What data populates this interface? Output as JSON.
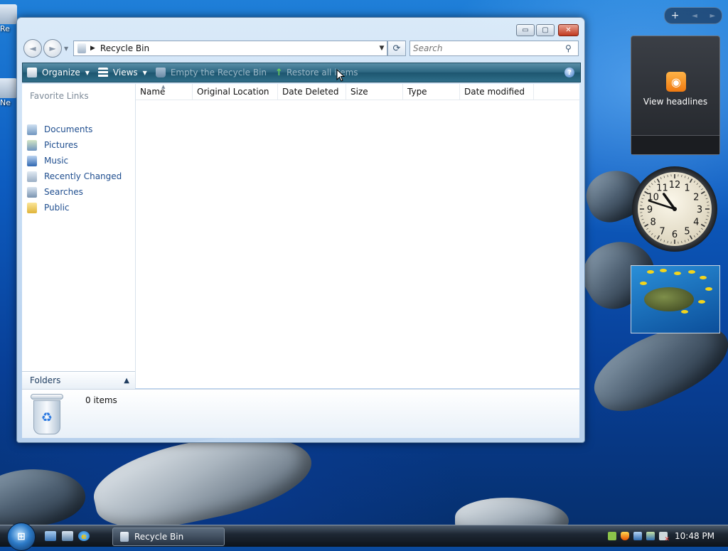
{
  "desktop": {
    "icons": [
      {
        "label": "Re"
      },
      {
        "label": "Ne"
      }
    ]
  },
  "sidebar": {
    "controls": {
      "add": "+",
      "prev": "◄",
      "next": "►"
    },
    "feed_gadget": {
      "text": "View headlines",
      "icon": "rss-icon"
    },
    "clock_gadget": {
      "numbers": [
        "12",
        "1",
        "2",
        "3",
        "4",
        "5",
        "6",
        "7",
        "8",
        "9",
        "10",
        "11"
      ],
      "hour": 10,
      "minute": 48
    },
    "slideshow_gadget": {
      "icon": "photo-turtle"
    }
  },
  "window": {
    "title": "Recycle Bin",
    "caption_buttons": {
      "minimize": "▭",
      "maximize": "▢",
      "close": "✕"
    },
    "address": {
      "path": "Recycle Bin"
    },
    "search": {
      "placeholder": "Search"
    },
    "toolbar": {
      "organize": "Organize",
      "views": "Views",
      "empty": "Empty the Recycle Bin",
      "restore": "Restore all items",
      "help": "?"
    },
    "nav_pane": {
      "title": "Favorite Links",
      "links": [
        {
          "label": "Documents",
          "icon": "documents-icon"
        },
        {
          "label": "Pictures",
          "icon": "pictures-icon"
        },
        {
          "label": "Music",
          "icon": "music-icon"
        },
        {
          "label": "Recently Changed",
          "icon": "recently-changed-icon"
        },
        {
          "label": "Searches",
          "icon": "searches-icon"
        },
        {
          "label": "Public",
          "icon": "public-folder-icon"
        }
      ],
      "folders_label": "Folders"
    },
    "columns": [
      "Name",
      "Original Location",
      "Date Deleted",
      "Size",
      "Type",
      "Date modified"
    ],
    "items": [],
    "details": {
      "count_text": "0 items"
    }
  },
  "taskbar": {
    "task_label": "Recycle Bin",
    "clock": "10:48 PM"
  },
  "colors": {
    "command_bar": "#2c6681",
    "link": "#1f4e8f",
    "close_button": "#c1391f"
  }
}
